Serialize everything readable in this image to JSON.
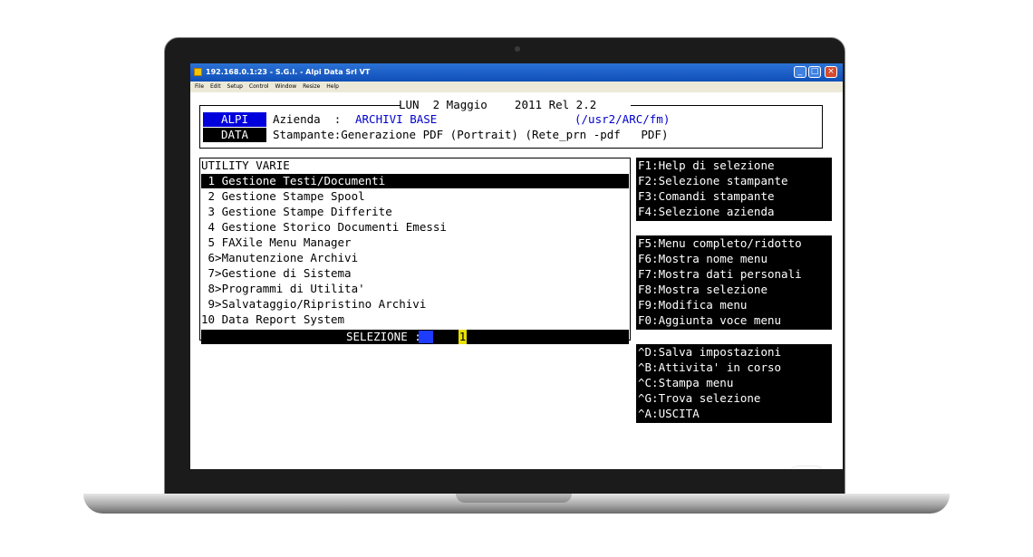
{
  "window": {
    "title": "192.168.0.1:23 - S.G.I. - Alpi Data Srl VT",
    "buttons": [
      "minimize-icon",
      "maximize-icon",
      "close-icon"
    ]
  },
  "menubar": [
    "File",
    "Edit",
    "Setup",
    "Control",
    "Window",
    "Resize",
    "Help"
  ],
  "header": {
    "date_line": "LUN  2 Maggio    2011 Rel 2.2",
    "badge1": "ALPI",
    "badge2": "DATA",
    "azienda_label": "Azienda  :",
    "azienda_value": "ARCHIVI BASE",
    "path": "(/usr2/ARC/fm)",
    "stampante_line": "Stampante:Generazione PDF (Portrait) (Rete_prn -pdf   PDF)"
  },
  "menu": {
    "title": "UTILITY VARIE",
    "items": [
      " 1 Gestione Testi/Documenti",
      " 2 Gestione Stampe Spool",
      " 3 Gestione Stampe Differite",
      " 4 Gestione Storico Documenti Emessi",
      " 5 FAXile Menu Manager",
      " 6>Manutenzione Archivi",
      " 7>Gestione di Sistema",
      " 8>Programmi di Utilita'",
      " 9>Salvataggio/Ripristino Archivi",
      "10 Data Report System"
    ],
    "selection_label": "SELEZIONE :",
    "selection_value": "1"
  },
  "fkeys_1": [
    "F1:Help di selezione",
    "F2:Selezione stampante",
    "F3:Comandi stampante",
    "F4:Selezione azienda"
  ],
  "fkeys_2": [
    "F5:Menu completo/ridotto",
    "F6:Mostra nome menu",
    "F7:Mostra dati personali",
    "F8:Mostra selezione",
    "F9:Modifica menu",
    "F0:Aggiunta voce menu"
  ],
  "fkeys_3": [
    "^D:Salva impostazioni",
    "^B:Attivita' in corso",
    "^C:Stampa menu",
    "^G:Trova selezione",
    "^A:USCITA"
  ],
  "colors": {
    "titlebar": "#0f4fb8",
    "terminal_bg": "#ffffff",
    "highlight": "#000000",
    "accent_blue": "#0000cc",
    "cursor": "#1e3cff"
  }
}
